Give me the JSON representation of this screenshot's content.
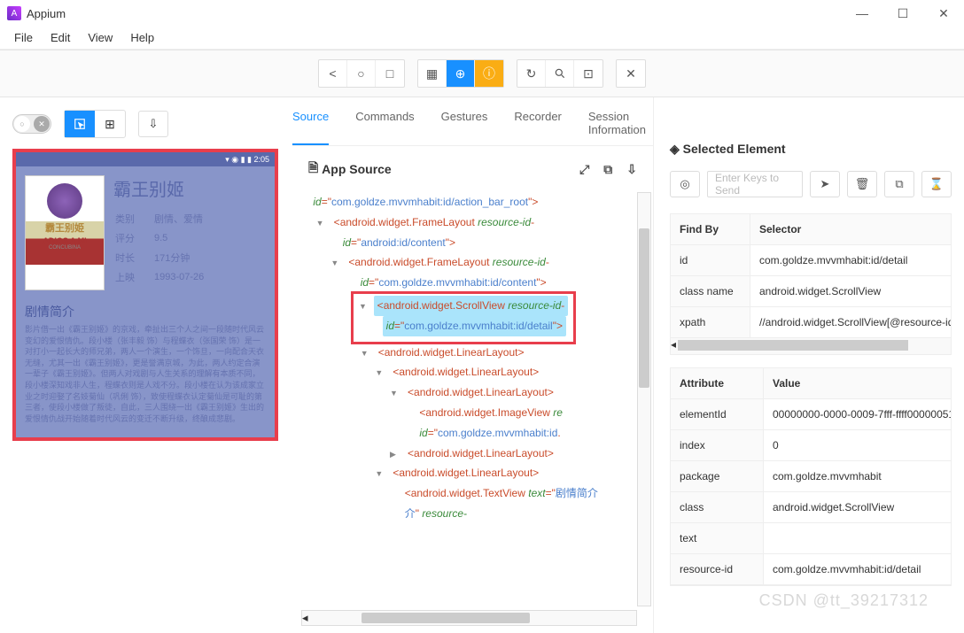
{
  "window": {
    "title": "Appium"
  },
  "menu": {
    "file": "File",
    "edit": "Edit",
    "view": "View",
    "help": "Help"
  },
  "tabs": {
    "source": "Source",
    "commands": "Commands",
    "gestures": "Gestures",
    "recorder": "Recorder",
    "session": "Session Information"
  },
  "app_source": {
    "title": "App Source"
  },
  "tree": {
    "root_id": "com.goldze.mvvmhabit:id/action_bar_root",
    "fl1": "android.widget.FrameLayout",
    "fl1_rid": "resource-id",
    "fl1_val": "android:id/content",
    "fl2": "android.widget.FrameLayout",
    "fl2_rid": "resource-id",
    "fl2_val": "com.goldze.mvvmhabit:id/content",
    "sv": "android.widget.ScrollView",
    "sv_rid": "resource-id",
    "sv_val": "com.goldze.mvvmhabit:id/detail",
    "ll": "android.widget.LinearLayout",
    "iv": "android.widget.ImageView",
    "iv_rid": "com.goldze.mvvmhabit:id",
    "tv": "android.widget.TextView",
    "tv_txt": "剧情简介",
    "tv_attr": "text",
    "tv_res": "resource-"
  },
  "selected": {
    "title": "Selected Element",
    "input_placeholder": "Enter Keys to Send",
    "findby": "Find By",
    "selector": "Selector",
    "rows": {
      "id_k": "id",
      "id_v": "com.goldze.mvvmhabit:id/detail",
      "cn_k": "class name",
      "cn_v": "android.widget.ScrollView",
      "xp_k": "xpath",
      "xp_v": "//android.widget.ScrollView[@resource-id=\"com"
    },
    "attribute": "Attribute",
    "value": "Value",
    "attrs": {
      "eid_k": "elementId",
      "eid_v": "00000000-0000-0009-7fff-ffff00000051",
      "idx_k": "index",
      "idx_v": "0",
      "pkg_k": "package",
      "pkg_v": "com.goldze.mvvmhabit",
      "cls_k": "class",
      "cls_v": "android.widget.ScrollView",
      "txt_k": "text",
      "txt_v": "",
      "rid_k": "resource-id",
      "rid_v": "com.goldze.mvvmhabit:id/detail"
    }
  },
  "phone": {
    "status": "▾ ◉ ▮ ▮ 2:05",
    "title": "霸王别姬",
    "poster_cn": "霸王别姫",
    "poster_en": "ADIOS A MI",
    "poster_sub": "CONCUBINA",
    "k_cat": "类别",
    "v_cat": "剧情、爱情",
    "k_rate": "评分",
    "v_rate": "9.5",
    "k_dur": "时长",
    "v_dur": "171分钟",
    "k_rel": "上映",
    "v_rel": "1993-07-26",
    "syn_h": "剧情简介",
    "syn": "影片借一出《霸王别姬》的京戏，牵扯出三个人之间一段随时代风云变幻的爱恨情仇。段小楼（张丰毅 饰）与程蝶衣（张国荣 饰）是一对打小一起长大的师兄弟，两人一个演生，一个饰旦，一向配合天衣无缝，尤其一出《霸王别姬》，更是誉满京城，为此，两人约定合演一辈子《霸王别姬》。但两人对戏剧与人生关系的理解有本质不同，段小楼深知戏非人生，程蝶衣则是人戏不分。段小楼在认为该成家立业之时迎娶了名妓菊仙（巩俐 饰），致使程蝶衣认定菊仙是可耻的第三者，使段小楼做了叛徒，自此，三人围绕一出《霸王别姬》生出的爱恨情仇战开始随着时代风云的变迁不断升级，终酿成悲剧。"
  },
  "watermark": "CSDN @tt_39217312"
}
